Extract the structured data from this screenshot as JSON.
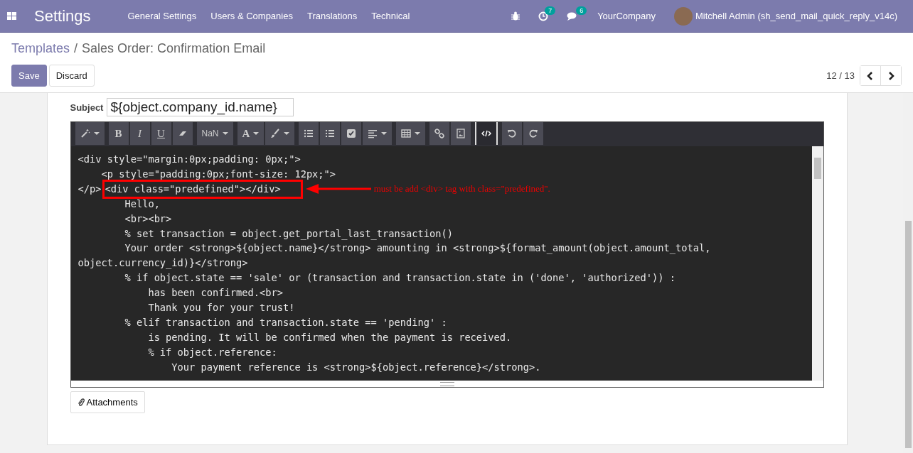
{
  "navbar": {
    "app_title": "Settings",
    "menu": [
      "General Settings",
      "Users & Companies",
      "Translations",
      "Technical"
    ],
    "activity_count": "7",
    "message_count": "6",
    "company": "YourCompany",
    "user": "Mitchell Admin (sh_send_mail_quick_reply_v14c)"
  },
  "breadcrumb": {
    "parent": "Templates",
    "separator": "/",
    "current": "Sales Order: Confirmation Email"
  },
  "buttons": [
    {
      "label": "Save",
      "kind": "primary"
    },
    {
      "label": "Discard",
      "kind": "secondary"
    }
  ],
  "pager": {
    "text": "12 / 13"
  },
  "subject": {
    "label": "Subject",
    "value": "${object.company_id.name}"
  },
  "toolbar": [
    [
      {
        "kind": "icon",
        "caret": true,
        "selected": false
      }
    ],
    [
      {
        "kind": "text",
        "label": "B",
        "caret": false,
        "selected": false
      },
      {
        "kind": "text",
        "label": "I",
        "caret": false,
        "selected": false
      },
      {
        "kind": "text",
        "label": "U",
        "caret": false,
        "selected": false
      },
      {
        "kind": "icon",
        "caret": false,
        "selected": false
      }
    ],
    [
      {
        "kind": "text",
        "label": "NaN",
        "caret": true,
        "selected": false
      }
    ],
    [
      {
        "kind": "text",
        "label": "A",
        "caret": true,
        "selected": false
      },
      {
        "kind": "icon",
        "caret": true,
        "selected": false
      }
    ],
    [
      {
        "kind": "icon",
        "caret": false,
        "selected": false
      },
      {
        "kind": "icon",
        "caret": false,
        "selected": false
      },
      {
        "kind": "icon",
        "caret": false,
        "selected": false
      },
      {
        "kind": "icon",
        "caret": true,
        "selected": false
      }
    ],
    [
      {
        "kind": "icon",
        "caret": true,
        "selected": false
      }
    ],
    [
      {
        "kind": "icon",
        "caret": false,
        "selected": false
      },
      {
        "kind": "icon",
        "caret": false,
        "selected": false
      }
    ],
    [
      {
        "kind": "icon",
        "caret": false,
        "selected": true
      }
    ],
    [
      {
        "kind": "icon",
        "caret": false,
        "selected": false
      },
      {
        "kind": "icon",
        "caret": false,
        "selected": false
      }
    ]
  ],
  "code_lines": [
    {
      "text": "<div style=\"margin:0px;padding: 0px;\">"
    },
    {
      "text": "    <p style=\"padding:0px;font-size: 12px;\">"
    },
    {
      "text": "</p>",
      "boxed": "<div class=\"predefined\"></div>",
      "annotation": "must be add <div> tag with class=\"predefined\"."
    },
    {
      "text": "        Hello,"
    },
    {
      "text": "        <br><br>"
    },
    {
      "text": "        % set transaction = object.get_portal_last_transaction()"
    },
    {
      "text": "        Your order <strong>${object.name}</strong> amounting in <strong>${format_amount(object.amount_total,"
    },
    {
      "text": "object.currency_id)}</strong>"
    },
    {
      "text": "        % if object.state == 'sale' or (transaction and transaction.state in ('done', 'authorized')) :"
    },
    {
      "text": "            has been confirmed.<br>"
    },
    {
      "text": "            Thank you for your trust!"
    },
    {
      "text": "        % elif transaction and transaction.state == 'pending' :"
    },
    {
      "text": "            is pending. It will be confirmed when the payment is received."
    },
    {
      "text": "            % if object.reference:"
    },
    {
      "text": "                Your payment reference is <strong>${object.reference}</strong>."
    }
  ],
  "attachments_button": "Attachments"
}
